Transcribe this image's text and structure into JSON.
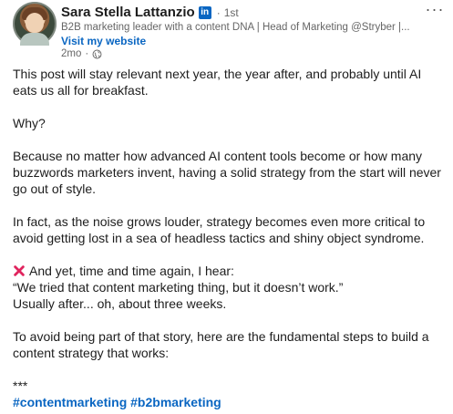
{
  "author": {
    "name": "Sara Stella Lattanzio",
    "badge": "in",
    "degree": "1st",
    "headline": "B2B marketing leader with a content DNA | Head of Marketing @Stryber |...",
    "visit_link": "Visit my website",
    "time_ago": "2mo",
    "visibility_icon": "globe-icon"
  },
  "menu": {
    "more_label": "···"
  },
  "post": {
    "paragraphs": [
      "This post will stay relevant next year, the year after, and probably until AI eats us all for breakfast.",
      "Why?",
      "Because no matter how advanced AI content tools become or how many buzzwords marketers invent, having a solid strategy from the start will never go out of style.",
      "In fact, as the noise grows louder, strategy becomes even more critical to avoid getting lost in a sea of headless tactics and shiny object syndrome."
    ],
    "quote_lines": [
      "And yet, time and time again, I hear:",
      "“We tried that content marketing thing, but it doesn’t work.”",
      "Usually after... oh, about three weeks."
    ],
    "closing": "To avoid being part of that story, here are the fundamental steps to build a content strategy that works:",
    "separator": "***",
    "hashtags": [
      "#contentmarketing",
      "#b2bmarketing"
    ]
  },
  "colors": {
    "link": "#0a66c2",
    "muted": "#666666",
    "text": "#1d1d1d",
    "cross": "#e0245e"
  }
}
